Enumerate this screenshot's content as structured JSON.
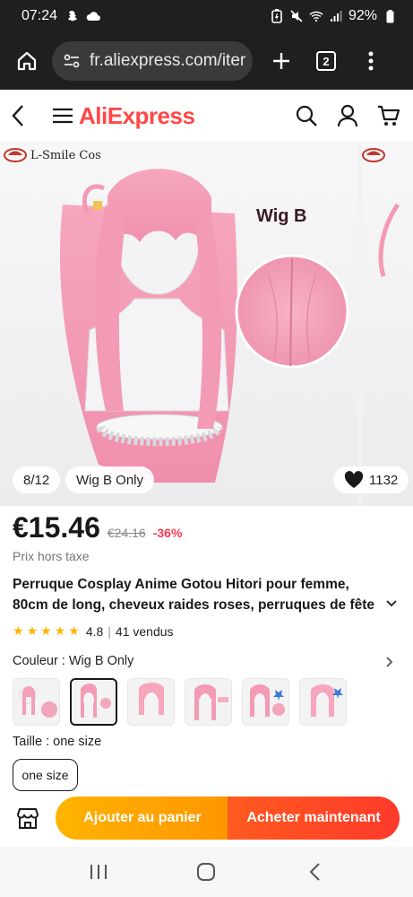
{
  "status_bar": {
    "time": "07:24",
    "battery": "92%"
  },
  "browser": {
    "url": "fr.aliexpress.com/iter",
    "tab_count": "2"
  },
  "header": {
    "logo": "AliExpress"
  },
  "gallery": {
    "brand": "L-Smile Cos",
    "image_label": "Wig B",
    "counter": "8/12",
    "variant_tag": "Wig B Only",
    "wishlist_count": "1132"
  },
  "product": {
    "price": "€15.46",
    "original_price": "€24.16",
    "discount": "-36%",
    "tax_note": "Prix hors taxe",
    "title_line1": "Perruque Cosplay Anime Gotou Hitori pour femme,",
    "title_line2": "80cm de long, cheveux raides roses, perruques de fête",
    "rating": "4.8",
    "sold": "41 vendus",
    "rating_stars": 5
  },
  "options": {
    "color_label": "Couleur : Wig B Only",
    "size_label": "Taille : one size",
    "size_value": "one size"
  },
  "actions": {
    "add_to_cart": "Ajouter au panier",
    "buy_now": "Acheter maintenant"
  },
  "colors": {
    "brand": "#ff4747",
    "cart": "#ffa000",
    "buy": "#ff4a1f",
    "discount": "#fd384f"
  }
}
